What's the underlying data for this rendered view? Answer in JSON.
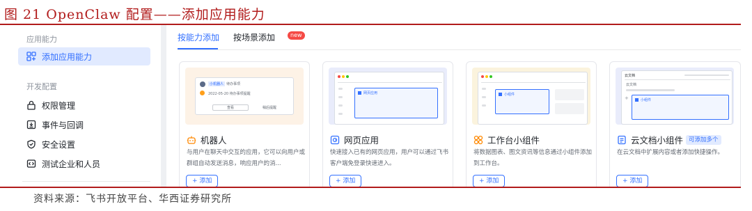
{
  "figure": {
    "title": "图 21 OpenClaw 配置——添加应用能力",
    "source": "资料来源：飞书开放平台、华西证券研究所"
  },
  "colors": {
    "accent": "#3370ff",
    "report_red": "#b11b1b",
    "badge_red": "#f54a45",
    "active_bg": "#e1eaff"
  },
  "sidebar": {
    "group1_label": "应用能力",
    "active_item": {
      "label": "添加应用能力",
      "icon": "grid-plus-icon"
    },
    "group2_label": "开发配置",
    "items": [
      {
        "label": "权限管理",
        "icon": "lock-icon"
      },
      {
        "label": "事件与回调",
        "icon": "event-icon"
      },
      {
        "label": "安全设置",
        "icon": "shield-icon"
      },
      {
        "label": "测试企业和人员",
        "icon": "code-icon"
      }
    ]
  },
  "tabs": [
    {
      "label": "按能力添加",
      "active": true
    },
    {
      "label": "按场景添加",
      "active": false,
      "badge": "new"
    }
  ],
  "cards": [
    {
      "title": "机器人",
      "icon": "robot-icon",
      "description": "与用户在聊天中交互的应用，它可以向用户或群组自动发送消息，响应用户的消...",
      "button": "+ 添加",
      "preview": {
        "bot_tag": "小机器人",
        "status_tag": "待办事项",
        "date_text": "2022-05-20 待办事项提醒",
        "primary_btn": "查看",
        "secondary_btn": "稍后提醒"
      }
    },
    {
      "title": "网页应用",
      "icon": "webpage-icon",
      "description": "快速接入已有的网页应用，用户可以通过飞书客户端免登录快速进入。",
      "button": "+ 添加",
      "preview": {
        "box_label": "网页应用"
      }
    },
    {
      "title": "工作台小组件",
      "icon": "widget-icon",
      "description": "将数据图表、图文资讯等信息通过小组件添加到工作台。",
      "button": "+ 添加",
      "preview": {
        "box_label": "小组件"
      }
    },
    {
      "title": "云文档小组件",
      "icon": "doc-icon",
      "badge": "可添加多个",
      "description": "在云文档中扩展内容或者添加快捷操作。",
      "button": "+ 添加",
      "preview": {
        "header": "云文档",
        "sub": "云文档",
        "box_label": "小组件"
      }
    }
  ]
}
